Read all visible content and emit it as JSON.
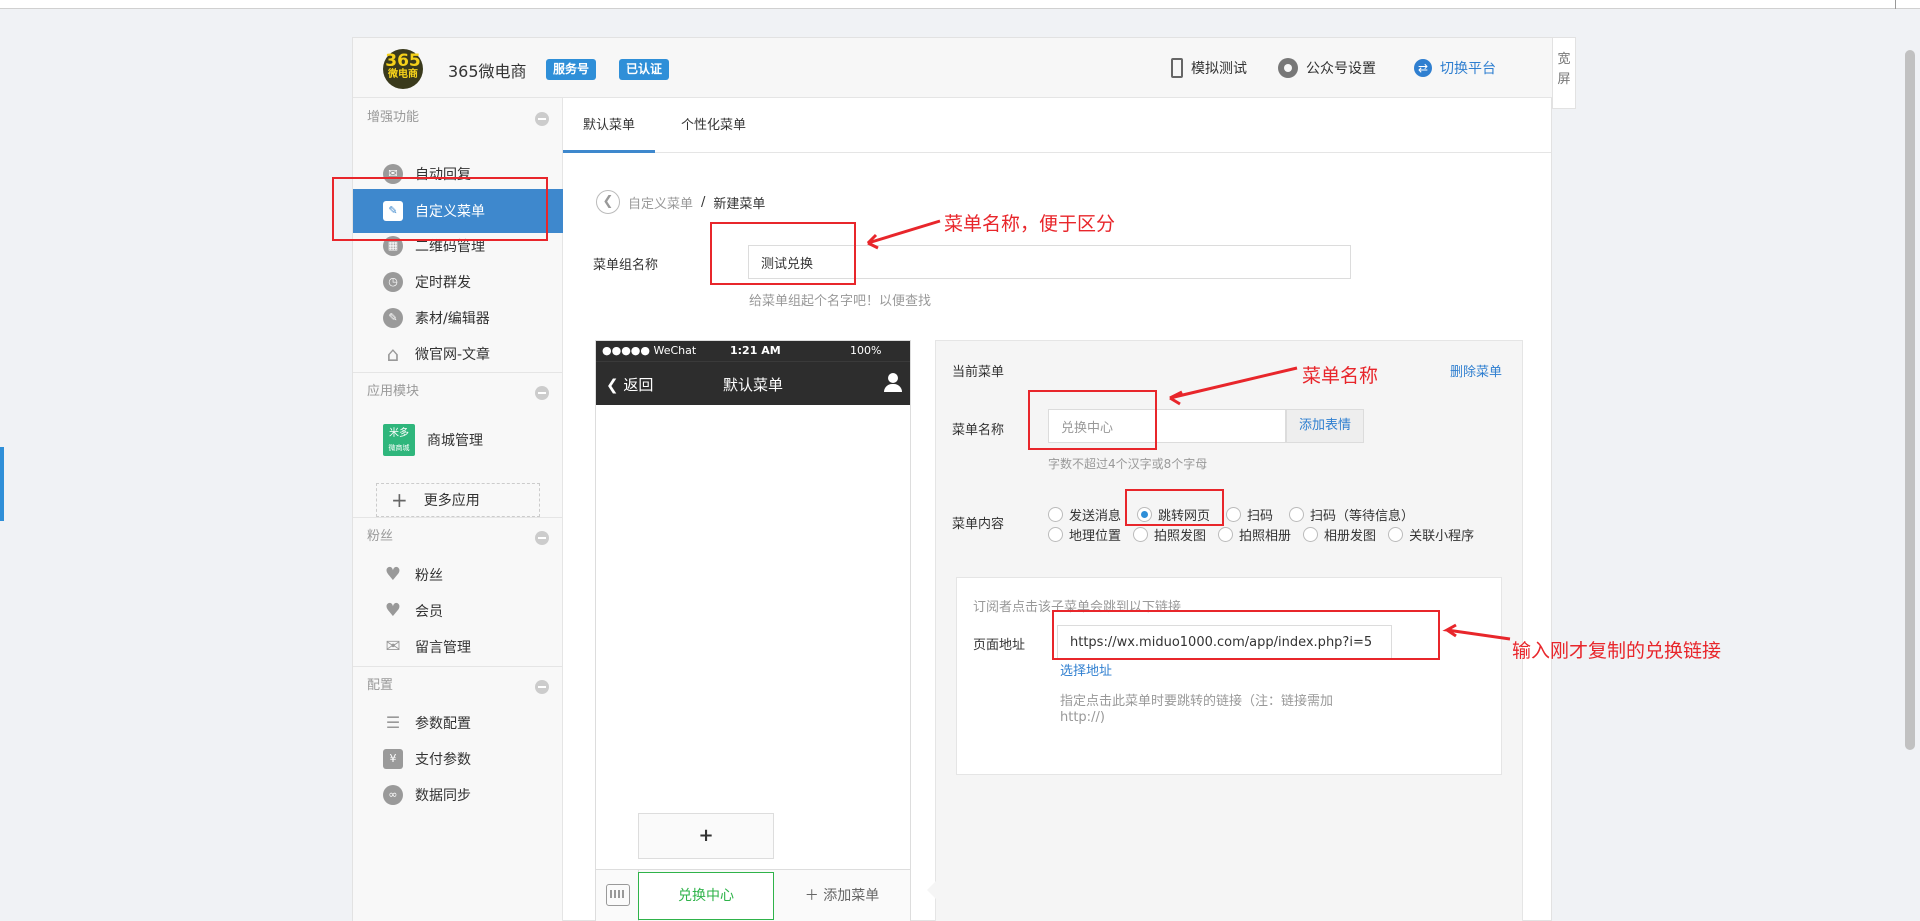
{
  "header": {
    "logo_top": "365",
    "logo_bottom": "微电商",
    "brand": "365微电商",
    "badge_service": "服务号",
    "badge_verified": "已认证",
    "simulate": "模拟测试",
    "settings": "公众号设置",
    "switch": "切换平台",
    "wide_top": "宽",
    "wide_bottom": "屏"
  },
  "sidebar": {
    "sections": [
      {
        "title": "增强功能"
      },
      {
        "title": "应用模块"
      },
      {
        "title": "粉丝"
      },
      {
        "title": "配置"
      }
    ],
    "items": [
      {
        "label": "自动回复"
      },
      {
        "label": "自定义菜单"
      },
      {
        "label": "二维码管理"
      },
      {
        "label": "定时群发"
      },
      {
        "label": "素材/编辑器"
      },
      {
        "label": "微官网-文章"
      },
      {
        "label": "商城管理",
        "icon_top": "米多",
        "icon_bottom": "微商城"
      },
      {
        "label": "更多应用"
      },
      {
        "label": "粉丝"
      },
      {
        "label": "会员"
      },
      {
        "label": "留言管理"
      },
      {
        "label": "参数配置"
      },
      {
        "label": "支付参数"
      },
      {
        "label": "数据同步"
      }
    ]
  },
  "tabs": [
    "默认菜单",
    "个性化菜单"
  ],
  "breadcrumb": {
    "parent": "自定义菜单",
    "sep": "/",
    "current": "新建菜单"
  },
  "menu_group": {
    "label": "菜单组名称",
    "value": "测试兑换",
    "hint": "给菜单组起个名字吧！以便查找"
  },
  "phone": {
    "status_left": "●●●●● WeChat",
    "status_time": "1:21 AM",
    "status_battery": "100%",
    "back": "返回",
    "title": "默认菜单",
    "sub_add": "+",
    "menu_main": "兑换中心",
    "menu_add": "添加菜单"
  },
  "editor": {
    "title": "当前菜单",
    "delete": "删除菜单",
    "name_label": "菜单名称",
    "name_placeholder": "兑换中心",
    "add_emoji": "添加表情",
    "name_hint": "字数不超过4个汉字或8个字母",
    "content_label": "菜单内容",
    "options_row1": [
      "发送消息",
      "跳转网页",
      "扫码",
      "扫码（等待信息）"
    ],
    "options_row2": [
      "地理位置",
      "拍照发图",
      "拍照相册",
      "相册发图",
      "关联小程序"
    ],
    "selected_option": "跳转网页",
    "link_intro": "订阅者点击该子菜单会跳到以下链接",
    "url_label": "页面地址",
    "url_value": "https://wx.miduo1000.com/app/index.php?i=5",
    "select_url": "选择地址",
    "url_hint_1": "指定点击此菜单时要跳转的链接（注：链接需加",
    "url_hint_2": "http://)"
  },
  "annotations": {
    "a1": "菜单名称，便于区分",
    "a2": "菜单名称",
    "a3": "输入刚才复制的兑换链接",
    "color": "#e8262b"
  }
}
